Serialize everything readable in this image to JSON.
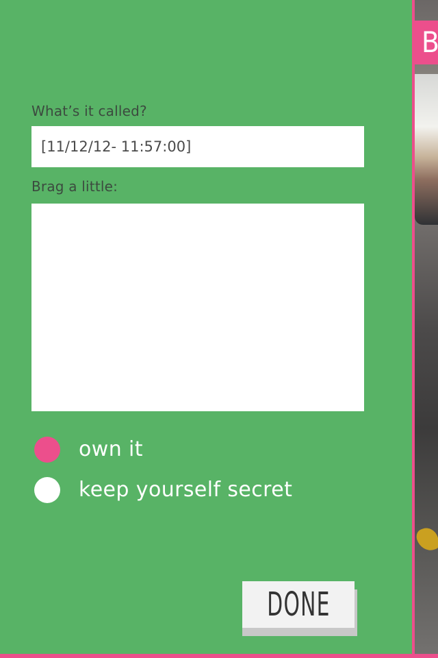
{
  "form": {
    "name_label": "What’s it called?",
    "name_value": "[11/12/12- 11:57:00]",
    "brag_label": "Brag a little:",
    "brag_value": ""
  },
  "privacy_options": [
    {
      "label": "own it",
      "selected": true
    },
    {
      "label": "keep yourself secret",
      "selected": false
    }
  ],
  "done_button": {
    "label": "DONE"
  },
  "side_photo": {
    "tag_letter": "B"
  },
  "colors": {
    "background": "#58b366",
    "accent": "#ec4f8c",
    "field": "#ffffff"
  }
}
